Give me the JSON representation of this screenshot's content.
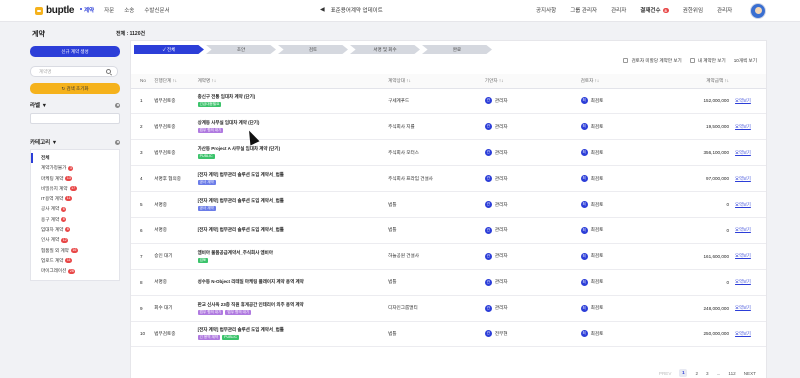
{
  "header": {
    "logo": "buptle",
    "nav": [
      "계약",
      "자문",
      "소송",
      "수발신문서"
    ],
    "notice": "표준용어계약 업데이트",
    "menu": [
      "공지사항",
      "그룹 관리자",
      "관리자"
    ],
    "approval_label": "결재건수",
    "approval_count": "8",
    "menu_right": [
      "권한위임",
      "관리자"
    ]
  },
  "sidebar": {
    "title": "계약",
    "new_button": "신규 계약 생성",
    "search_placeholder": "계약명",
    "reset_button": "검색 초기화",
    "label_title": "라벨",
    "category_title": "카테고리",
    "categories": [
      {
        "label": "전체",
        "count": ""
      },
      {
        "label": "계약가정불가",
        "count": "3"
      },
      {
        "label": "마케팅 계약",
        "count": "13"
      },
      {
        "label": "비밀유지 계약",
        "count": "17"
      },
      {
        "label": "IT용역 계약",
        "count": "11"
      },
      {
        "label": "공사 계약",
        "count": "6"
      },
      {
        "label": "용구 계약",
        "count": "8"
      },
      {
        "label": "임대차 계약",
        "count": "6"
      },
      {
        "label": "인사 계약",
        "count": "12"
      },
      {
        "label": "협품질 외 계약",
        "count": "16"
      },
      {
        "label": "업로드 계약",
        "count": "11"
      },
      {
        "label": "마이그레이션",
        "count": "26"
      }
    ]
  },
  "main": {
    "total_label": "전체 : 1120건",
    "steps": [
      "전체",
      "초안",
      "검토",
      "서명 및 회수",
      "완료"
    ],
    "filters": {
      "reviewer_check": "검토자 미할당 계약만 보기",
      "mine_check": "내 계약만 보기",
      "page_size": "10개씩 보기"
    },
    "columns": [
      "No",
      "진행단계",
      "계약명",
      "계약상대",
      "기안자",
      "검토자",
      "계약금액",
      ""
    ],
    "rows": [
      {
        "no": "1",
        "stage": "법무검토중",
        "name": "충신구 전통 임대차 계약 (단기)",
        "tags": [
          {
            "text": "긴급대응필요",
            "color": "green"
          }
        ],
        "party": "구세계푸드",
        "drafter": "관리자",
        "reviewer": "최검토",
        "amount": "152,000,000",
        "view": "요약보기"
      },
      {
        "no": "2",
        "stage": "법무검토중",
        "name": "상계동 사무실 임대차 계약 (단기)",
        "tags": [
          {
            "text": "법무 협의 대기",
            "color": "purple"
          }
        ],
        "party": "주식회사 지률",
        "drafter": "관리자",
        "reviewer": "최검토",
        "amount": "19,500,000",
        "view": "요약보기"
      },
      {
        "no": "3",
        "stage": "법무검토중",
        "name": "가산동 Project A 사무실 임대차 계약 (단기)",
        "tags": [
          {
            "text": "PUBLIC",
            "color": "green"
          }
        ],
        "party": "주식회사 모터스",
        "drafter": "관리자",
        "reviewer": "최검토",
        "amount": "356,100,000",
        "view": "요약보기"
      },
      {
        "no": "4",
        "stage": "서명후 협의중",
        "name": "[전자 계약] 법무관리 솔루션 도입 계약서_법틀",
        "tags": [
          {
            "text": "공사 계약",
            "color": "blue"
          }
        ],
        "party": "주식회사 프라임 건설사",
        "drafter": "관리자",
        "reviewer": "최검토",
        "amount": "97,000,000",
        "view": "요약보기"
      },
      {
        "no": "5",
        "stage": "서명중",
        "name": "[전자 계약] 법무관리 솔루션 도입 계약서_법틀",
        "tags": [
          {
            "text": "공사 계약",
            "color": "blue"
          }
        ],
        "party": "법틀",
        "drafter": "관리자",
        "reviewer": "최검토",
        "amount": "0",
        "view": "요약보기"
      },
      {
        "no": "6",
        "stage": "서명중",
        "name": "[전자 계약] 법무관리 솔루션 도입 계약서_법틀",
        "tags": [],
        "party": "법틀",
        "drafter": "관리자",
        "reviewer": "최검토",
        "amount": "0",
        "view": "요약보기"
      },
      {
        "no": "7",
        "stage": "승인 대기",
        "name": "엠비아 물품공급계약서_주식회사 엠비아",
        "tags": [
          {
            "text": "검토",
            "color": "green"
          }
        ],
        "party": "하늘공원 건설사",
        "drafter": "관리자",
        "reviewer": "최검토",
        "amount": "161,600,000",
        "view": "요약보기"
      },
      {
        "no": "8",
        "stage": "서명중",
        "name": "성수동 N-Object 리테일 마케팅 플래이지 계약 용역 계약",
        "tags": [],
        "party": "법틀",
        "drafter": "관리자",
        "reviewer": "최검토",
        "amount": "0",
        "view": "요약보기"
      },
      {
        "no": "9",
        "stage": "회수 대기",
        "name": "판교 신사옥 23층 직원 휴게공간 인테리어 외주 용역 계약",
        "tags": [
          {
            "text": "법무 협의 대기",
            "color": "purple"
          },
          {
            "text": "법무 협의 대기",
            "color": "purple"
          }
        ],
        "party": "디자인그룹멀티",
        "drafter": "관리자",
        "reviewer": "최검토",
        "amount": "248,000,000",
        "view": "요약보기"
      },
      {
        "no": "10",
        "stage": "법무검토중",
        "name": "[전자 계약] 법무관리 솔루션 도입 계약서_법틀",
        "tags": [
          {
            "text": "긴 용역 계약",
            "color": "purple"
          },
          {
            "text": "PUBLIC",
            "color": "green"
          }
        ],
        "party": "법틀",
        "drafter": "전무현",
        "reviewer": "최검토",
        "amount": "250,000,000",
        "view": "요약보기"
      }
    ],
    "pager": {
      "prev": "PREV",
      "pages": [
        "1",
        "2",
        "3",
        "...",
        "112"
      ],
      "next": "NEXT"
    }
  },
  "colors": {
    "primary": "#2c3ed8",
    "accent": "#f5b21c",
    "badge": "#e84747"
  }
}
